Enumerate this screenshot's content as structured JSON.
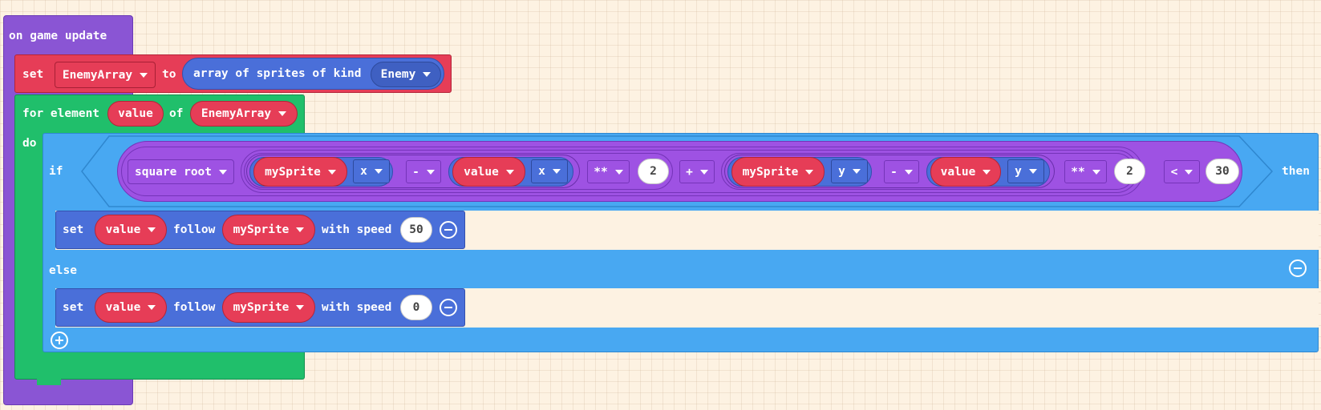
{
  "event_block": {
    "label": "on game update"
  },
  "set_block": {
    "set": "set",
    "variable": "EnemyArray",
    "to": "to",
    "array_label": "array of sprites of kind",
    "kind": "Enemy"
  },
  "for_block": {
    "for_label": "for element",
    "element_var": "value",
    "of_label": "of",
    "array_var": "EnemyArray",
    "do_label": "do"
  },
  "if_block": {
    "if_label": "if",
    "then_label": "then",
    "else_label": "else",
    "sqrt_op": "square root",
    "term1": {
      "sprite": "mySprite",
      "prop": "x",
      "minus": "-",
      "var": "value",
      "var_prop": "x",
      "pow": "**",
      "exp": "2"
    },
    "plus": "+",
    "term2": {
      "sprite": "mySprite",
      "prop": "y",
      "minus": "-",
      "var": "value",
      "var_prop": "y",
      "pow": "**",
      "exp": "2"
    },
    "compare_op": "<",
    "compare_value": "30"
  },
  "follow_then": {
    "set": "set",
    "var": "value",
    "follow": "follow",
    "target": "mySprite",
    "speed_label": "with speed",
    "speed": "50"
  },
  "follow_else": {
    "set": "set",
    "var": "value",
    "follow": "follow",
    "target": "mySprite",
    "speed_label": "with speed",
    "speed": "0"
  },
  "colors": {
    "event_purple": "#8a55d4",
    "variables_red": "#e63d57",
    "loops_green": "#20bf6b",
    "logic_blue": "#48a8f2",
    "sprites_blue": "#4a6fd9",
    "math_purple": "#9e52e3"
  }
}
